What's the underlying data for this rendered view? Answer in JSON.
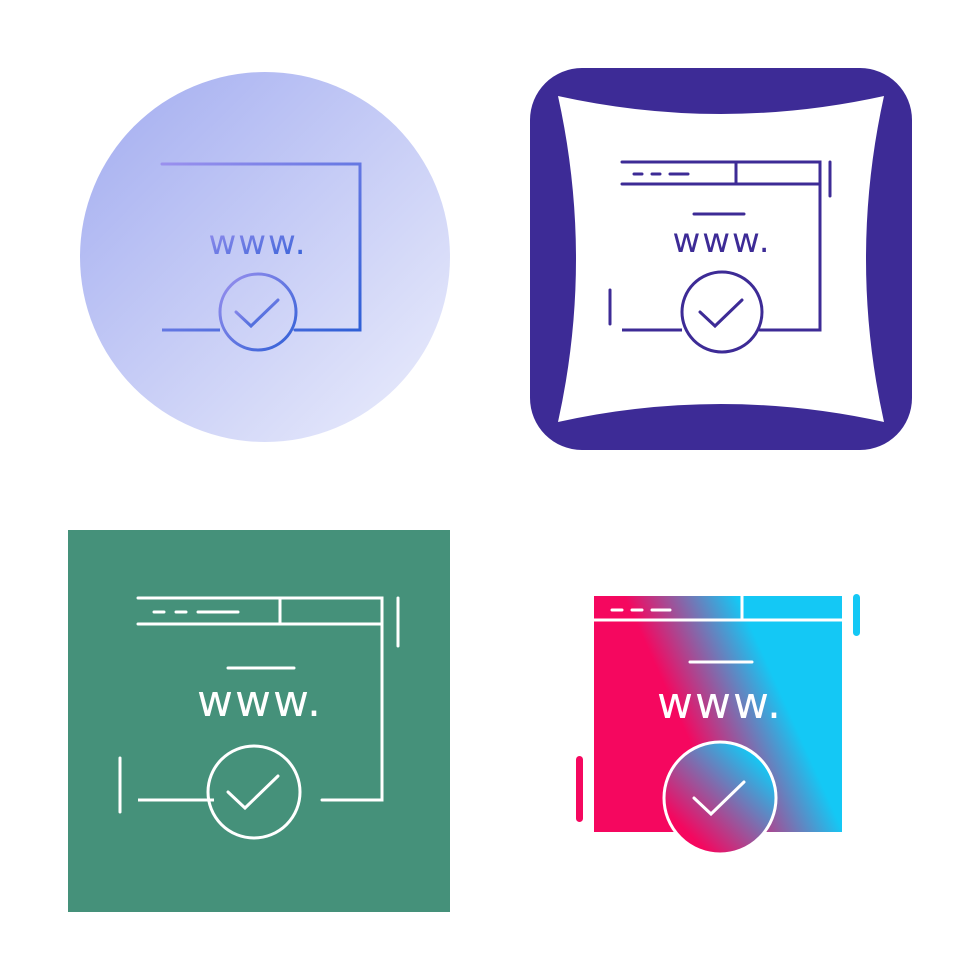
{
  "icons": [
    {
      "variant": "gradient-line-on-circle",
      "label": "www.",
      "colors": {
        "bg_from": "#a2acf0",
        "bg_to": "#e6e9fb",
        "line_from": "#8a86ee",
        "line_to": "#2f5fd6"
      }
    },
    {
      "variant": "glyph-on-rounded-square",
      "label": "www.",
      "colors": {
        "frame": "#3d2b96",
        "inner": "#ffffff",
        "line": "#3d2b96"
      }
    },
    {
      "variant": "white-line-on-square",
      "label": "www.",
      "colors": {
        "bg": "#45917a",
        "line": "#ffffff"
      }
    },
    {
      "variant": "gradient-fill",
      "label": "www.",
      "colors": {
        "from": "#f5075f",
        "to": "#14c8f5",
        "line": "#ffffff"
      }
    }
  ]
}
